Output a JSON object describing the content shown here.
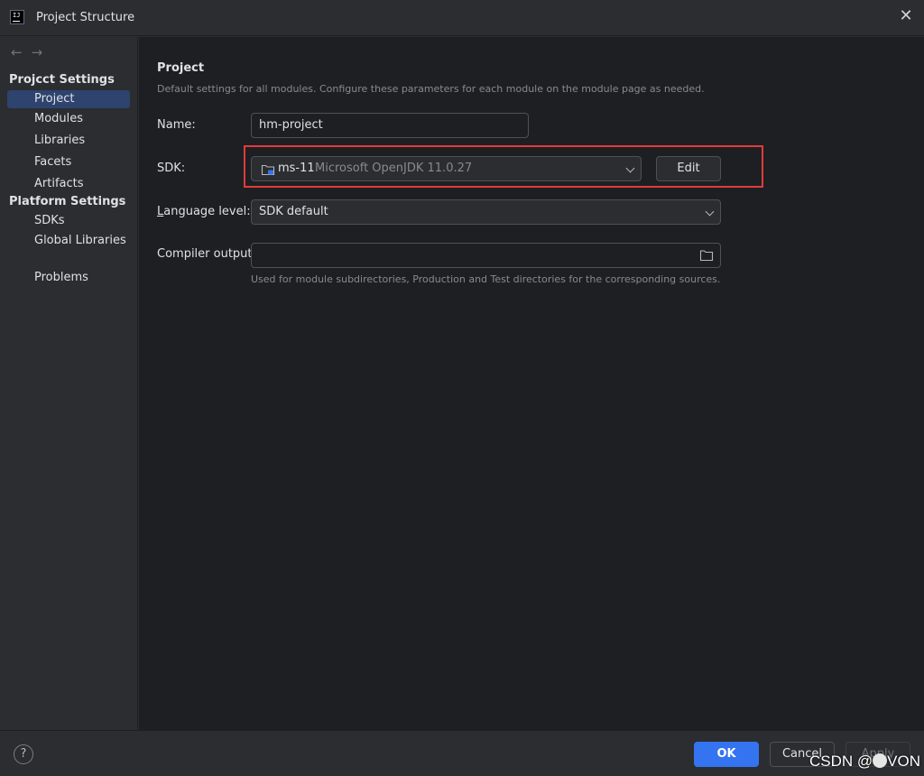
{
  "window": {
    "title": "Project Structure",
    "icon_name": "intellij-idea-icon",
    "close_icon": "close-icon"
  },
  "sidebar": {
    "nav": {
      "back_icon": "arrow-left-icon",
      "forward_icon": "arrow-right-icon"
    },
    "project_settings_title": "Projcct Settings",
    "project_items": [
      {
        "label": "Project",
        "selected": true
      },
      {
        "label": "Modules"
      },
      {
        "label": "Libraries"
      },
      {
        "label": "Facets"
      },
      {
        "label": "Artifacts"
      }
    ],
    "platform_settings_title": "Platform Settings",
    "platform_items": [
      {
        "label": "SDKs"
      },
      {
        "label": "Global Libraries"
      }
    ],
    "problems_label": "Problems"
  },
  "main": {
    "title": "Project",
    "description": "Default settings for all modules. Configure these parameters for each module on the module page as needed.",
    "name_label": "Name:",
    "name_value": "hm-project",
    "sdk_label": "SDK:",
    "sdk_name": "ms-11",
    "sdk_detail": "Microsoft OpenJDK 11.0.27",
    "edit_label": "Edit",
    "language_level_label_prefix": "L",
    "language_level_label_rest": "anguage level:",
    "language_level_value": "SDK default",
    "compiler_output_label": "Compiler output:",
    "compiler_output_value": "",
    "compiler_output_hint": "Used for module subdirectories, Production and Test directories for the corresponding sources.",
    "highlight_color": "#e03c3c"
  },
  "footer": {
    "help_label": "?",
    "ok_label": "OK",
    "cancel_label": "Cancel",
    "apply_label": "Apply",
    "watermark": "CSDN @",
    "watermark_suffix": "VON",
    "accent_color": "#3574f0"
  }
}
